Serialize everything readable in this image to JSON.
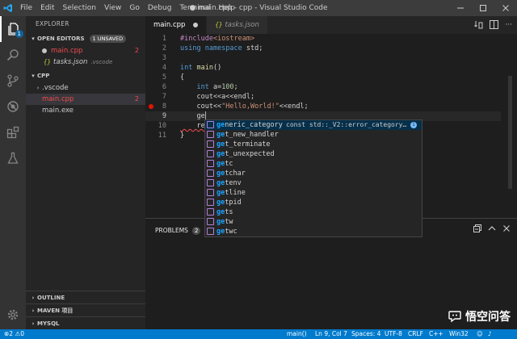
{
  "titlebar": {
    "menu": [
      "File",
      "Edit",
      "Selection",
      "View",
      "Go",
      "Debug",
      "Terminal",
      "Help"
    ],
    "title": "● main.cpp - cpp - Visual Studio Code"
  },
  "activity": {
    "explorer_badge": "1"
  },
  "sidebar": {
    "header": "EXPLORER",
    "open_editors": {
      "label": "OPEN EDITORS",
      "badge": "1 UNSAVED",
      "files": [
        {
          "name": "main.cpp",
          "count": "2"
        },
        {
          "name": "tasks.json",
          "path": ".vscode"
        }
      ]
    },
    "folder": {
      "label": "CPP",
      "items": [
        {
          "name": ".vscode"
        },
        {
          "name": "main.cpp",
          "count": "2"
        },
        {
          "name": "main.exe"
        }
      ]
    },
    "bottom": [
      "OUTLINE",
      "MAVEN 项目",
      "MYSQL"
    ]
  },
  "tabs": [
    {
      "label": "main.cpp"
    },
    {
      "label": "tasks.json"
    }
  ],
  "editor": {
    "line_numbers": [
      "1",
      "2",
      "3",
      "4",
      "5",
      "6",
      "7",
      "8",
      "9",
      "10",
      "11"
    ],
    "lines": {
      "l1a": "#include",
      "l1b": "<iostream>",
      "l2a": "using",
      "l2b": " namespace",
      "l2c": " std;",
      "l3": "",
      "l4a": "int",
      "l4b": " main",
      "l4c": "()",
      "l5": "{",
      "l6a": "    int",
      "l6b": " a=",
      "l6c": "100",
      "l6d": ";",
      "l7": "    cout<<a<<endl;",
      "l8a": "    cout<<",
      "l8b": "\"Hello,World!\"",
      "l8c": "<<endl;",
      "l9": "    ge",
      "l10": "    re",
      "l11": "}"
    }
  },
  "suggest": {
    "items": [
      {
        "hl": "ge",
        "rest": "neric_category",
        "detail": "const std::_V2::error_category…"
      },
      {
        "hl": "ge",
        "rest": "t_new_handler"
      },
      {
        "hl": "ge",
        "rest": "t_terminate"
      },
      {
        "hl": "ge",
        "rest": "t_unexpected"
      },
      {
        "hl": "ge",
        "rest": "tc"
      },
      {
        "hl": "ge",
        "rest": "tchar"
      },
      {
        "hl": "ge",
        "rest": "tenv"
      },
      {
        "hl": "ge",
        "rest": "tline"
      },
      {
        "hl": "ge",
        "rest": "tpid"
      },
      {
        "hl": "ge",
        "rest": "ts"
      },
      {
        "hl": "ge",
        "rest": "tw"
      },
      {
        "hl": "ge",
        "rest": "twc"
      }
    ],
    "info_icon": "i"
  },
  "panel": {
    "tab_label": "PROBLEMS",
    "count": "2"
  },
  "status": {
    "errors": "2",
    "warnings": "0",
    "function": "main()",
    "position": "Ln 9, Col 7",
    "spaces": "Spaces: 4",
    "encoding": "UTF-8",
    "eol": "CRLF",
    "language": "C++",
    "platform": "Win32"
  },
  "watermark": {
    "text": "悟空问答"
  },
  "colors": {
    "accent": "#007acc",
    "error": "#f14c4c",
    "highlight": "#18a3ff"
  }
}
